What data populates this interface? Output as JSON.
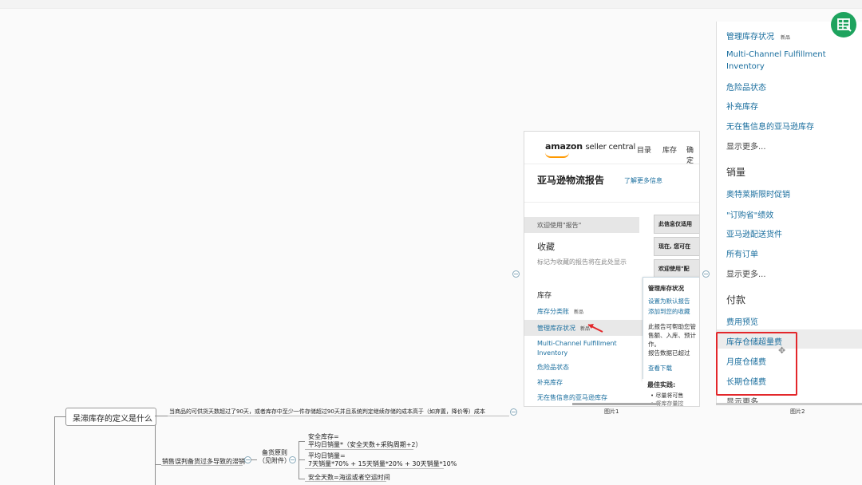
{
  "image1": {
    "logo_text": "amazon",
    "logo_suffix": "seller central",
    "nav": [
      "目录",
      "库存",
      "确定"
    ],
    "title": "亚马逊物流报告",
    "learn_more": "了解更多信息",
    "welcome": "欢迎使用\"报告\"",
    "favorites": "收藏",
    "favorites_hint": "标记为收藏的报告将在此处显示",
    "inventory_heading": "库存",
    "new_badge": "新品",
    "inventory_links": [
      "库存分类账",
      "管理库存状况",
      "Multi-Channel Fulfillment",
      "Inventory",
      "危险品状态",
      "补充库存",
      "无在售信息的亚马逊库存"
    ],
    "right_boxes": [
      "此信息仅适用",
      "现在, 您可在",
      "欢迎使用\"配"
    ],
    "popup": {
      "title": "管理库存状况",
      "link1": "设置为默认报告",
      "link2": "添加到您的收藏",
      "lines": [
        "此报告可帮助您管",
        "售额、入库、预计",
        "作。",
        "报告数据已超过"
      ],
      "view": "查看下载"
    },
    "best_practice": "最佳实践:",
    "bullets": [
      "尽量将可售",
      "将库存量控"
    ],
    "caption": "图片1"
  },
  "image2": {
    "items_top": [
      {
        "label": "管理库存状况",
        "badge": "新品"
      },
      {
        "label": "Multi-Channel Fulfillment"
      },
      {
        "label": "Inventory"
      },
      {
        "label": "危险品状态"
      },
      {
        "label": "补充库存"
      },
      {
        "label": "无在售信息的亚马逊库存"
      },
      {
        "label": "显示更多..."
      }
    ],
    "sales_heading": "销量",
    "sales_items": [
      "奥特莱斯限时促销",
      "\"订购省\"绩效",
      "亚马逊配送货件",
      "所有订单",
      "显示更多..."
    ],
    "payments_heading": "付款",
    "payment_items": [
      "费用预览",
      "库存仓储超量费",
      "月度仓储费",
      "长期仓储费",
      "显示更多..."
    ],
    "caption": "图片2"
  },
  "mindmap": {
    "root": "呆滞库存的定义是什么",
    "definition": "当商品的可供货天数超过了90天，或者库存中至少一件存储超过90天并且系统判定继续存储的成本高于（如弃置，降价等）成本",
    "cause": "销售误判备货过多导致的滞销",
    "principle": "备货原则",
    "principle_sub": "（见附件）",
    "safety_stock": "安全库存=",
    "safety_formula": "平均日销量*（安全天数+采购周期+2）",
    "avg_daily": "平均日销量=",
    "avg_formula": "7天销量*70% + 15天销量*20% + 30天销量*10%",
    "safety_days": "安全天数=海运或者空运时间"
  },
  "colors": {
    "accent_red": "#e3272b",
    "link_blue": "#1a6e9e",
    "icon_green": "#1ea35e"
  }
}
